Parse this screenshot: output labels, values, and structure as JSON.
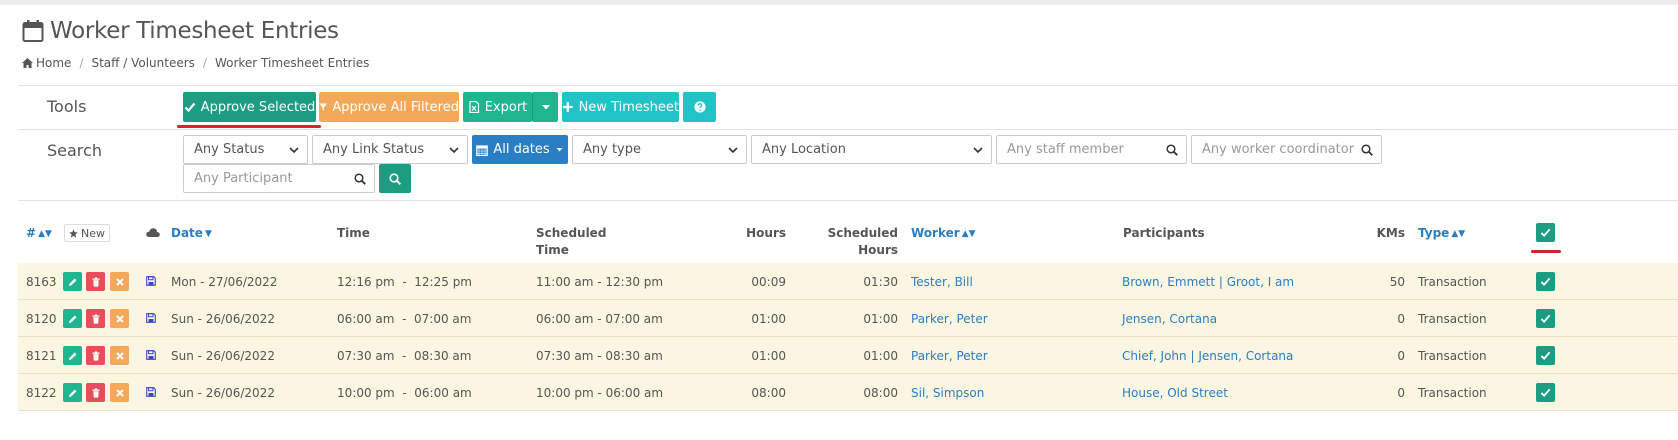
{
  "page": {
    "title": "Worker Timesheet Entries",
    "breadcrumb": [
      "Home",
      "Staff / Volunteers",
      "Worker Timesheet Entries"
    ]
  },
  "tools": {
    "label": "Tools",
    "approve_selected": "Approve Selected",
    "approve_all_filtered": "Approve All Filtered",
    "export": "Export",
    "new_timesheet": "New Timesheet"
  },
  "search": {
    "label": "Search",
    "status": "Any Status",
    "link_status": "Any Link Status",
    "dates": "All dates",
    "type": "Any type",
    "location": "Any Location",
    "staff_placeholder": "Any staff member",
    "coordinator_placeholder": "Any worker coordinator",
    "participant_placeholder": "Any Participant"
  },
  "table": {
    "headers": {
      "num": "#",
      "new": "New",
      "date": "Date",
      "time": "Time",
      "scheduled_time_1": "Scheduled",
      "scheduled_time_2": "Time",
      "hours": "Hours",
      "scheduled_hours_1": "Scheduled",
      "scheduled_hours_2": "Hours",
      "worker": "Worker",
      "participants": "Participants",
      "kms": "KMs",
      "type": "Type"
    },
    "rows": [
      {
        "id": "8163",
        "date": "Mon - 27/06/2022",
        "time": "12:16 pm  -  12:25 pm",
        "scheduled": "11:00 am - 12:30 pm",
        "hours": "00:09",
        "sched_hours": "01:30",
        "worker": "Tester, Bill",
        "participants": "Brown, Emmett | Groot, I am",
        "kms": "50",
        "type": "Transaction"
      },
      {
        "id": "8120",
        "date": "Sun - 26/06/2022",
        "time": "06:00 am  -  07:00 am",
        "scheduled": "06:00 am - 07:00 am",
        "hours": "01:00",
        "sched_hours": "01:00",
        "worker": "Parker, Peter",
        "participants": "Jensen, Cortana",
        "kms": "0",
        "type": "Transaction"
      },
      {
        "id": "8121",
        "date": "Sun - 26/06/2022",
        "time": "07:30 am  -  08:30 am",
        "scheduled": "07:30 am - 08:30 am",
        "hours": "01:00",
        "sched_hours": "01:00",
        "worker": "Parker, Peter",
        "participants": "Chief, John | Jensen, Cortana",
        "kms": "0",
        "type": "Transaction"
      },
      {
        "id": "8122",
        "date": "Sun - 26/06/2022",
        "time": "10:00 pm  -  06:00 am",
        "scheduled": "10:00 pm - 06:00 am",
        "hours": "08:00",
        "sched_hours": "08:00",
        "worker": "Sil, Simpson",
        "participants": "House, Old Street",
        "kms": "0",
        "type": "Transaction"
      }
    ]
  },
  "colors": {
    "approve": "#1c9d82",
    "approve_all": "#f4a95a",
    "export": "#1fb58e",
    "new": "#22c3c7",
    "dates": "#2a7ec3",
    "row_bg": "#fbf6e2",
    "highlight": "#d6252b"
  }
}
